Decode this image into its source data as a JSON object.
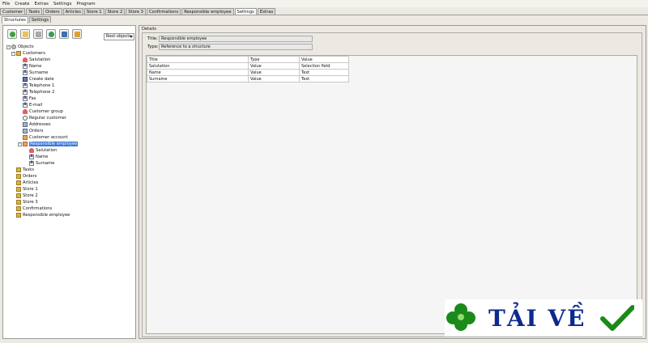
{
  "menu": [
    "File",
    "Create",
    "Extras",
    "Settings",
    "Program"
  ],
  "main_tabs": [
    "Customer",
    "Tasks",
    "Orders",
    "Articles",
    "Store 1",
    "Store 2",
    "Store 3",
    "Confirmations",
    "Responsible employee",
    "Settings",
    "Extras"
  ],
  "active_main_tab": "Settings",
  "sub_tabs": [
    "Structures",
    "Settings"
  ],
  "toolbar": {
    "combo": "Root objects"
  },
  "tree": {
    "root": "Objects",
    "customers": "Customers",
    "customer_fields": [
      "Salutation",
      "Name",
      "Surname",
      "Create date",
      "Telephone 1",
      "Telephone 2",
      "Fax",
      "E-mail",
      "Customer group",
      "Regular customer",
      "Addresses",
      "Orders",
      "Customer account"
    ],
    "selected": "Responsible employee",
    "selected_children": [
      "Salutation",
      "Name",
      "Surname"
    ],
    "others": [
      "Tasks",
      "Orders",
      "Articles",
      "Store 1",
      "Store 2",
      "Store 3",
      "Confirmations",
      "Responsible employee"
    ]
  },
  "details": {
    "group": "Details",
    "title_label": "Title:",
    "title_value": "Responsible employee",
    "type_label": "Type:",
    "type_value": "Reference to a structure",
    "columns": [
      "Title",
      "Type",
      "Value"
    ],
    "rows": [
      [
        "Salutation",
        "Value",
        "Selection field"
      ],
      [
        "Name",
        "Value",
        "Text"
      ],
      [
        "Surname",
        "Value",
        "Text"
      ]
    ]
  },
  "watermark": {
    "text": "TẢI VỀ",
    "green": "#1a8a1a",
    "blue": "#0b2a8f"
  }
}
